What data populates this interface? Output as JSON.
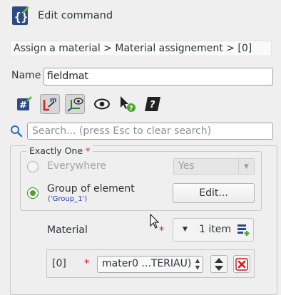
{
  "header": {
    "title": "Edit command",
    "icon": "edit-command-icon"
  },
  "breadcrumb": "Assign a material > Material assignement > [0]",
  "name_field": {
    "label": "Name",
    "value": "fieldmat"
  },
  "toolbar": {
    "buttons": [
      "hash-icon",
      "lm-icon",
      "axes-icon",
      "eye-icon",
      "pointer-help-icon",
      "doc-help-icon"
    ]
  },
  "search": {
    "placeholder": "Search... (press Esc to clear search)"
  },
  "exactly_one": {
    "title": "Exactly One",
    "required_mark": "*",
    "everywhere": {
      "label": "Everywhere",
      "value": "Yes",
      "selected": false
    },
    "group_of_element": {
      "label": "Group of element",
      "detail": "('Group_1')",
      "button": "Edit...",
      "selected": true
    }
  },
  "material": {
    "label": "Material",
    "required_mark": "*",
    "count_label": "1 item",
    "items": [
      {
        "index": "[0]",
        "required_mark": "*",
        "value": "mater0 ...TERIAU)"
      }
    ]
  },
  "colors": {
    "required": "#e0141e",
    "radio_on": "#4aa52d",
    "link_blue": "#2a3fb4"
  }
}
